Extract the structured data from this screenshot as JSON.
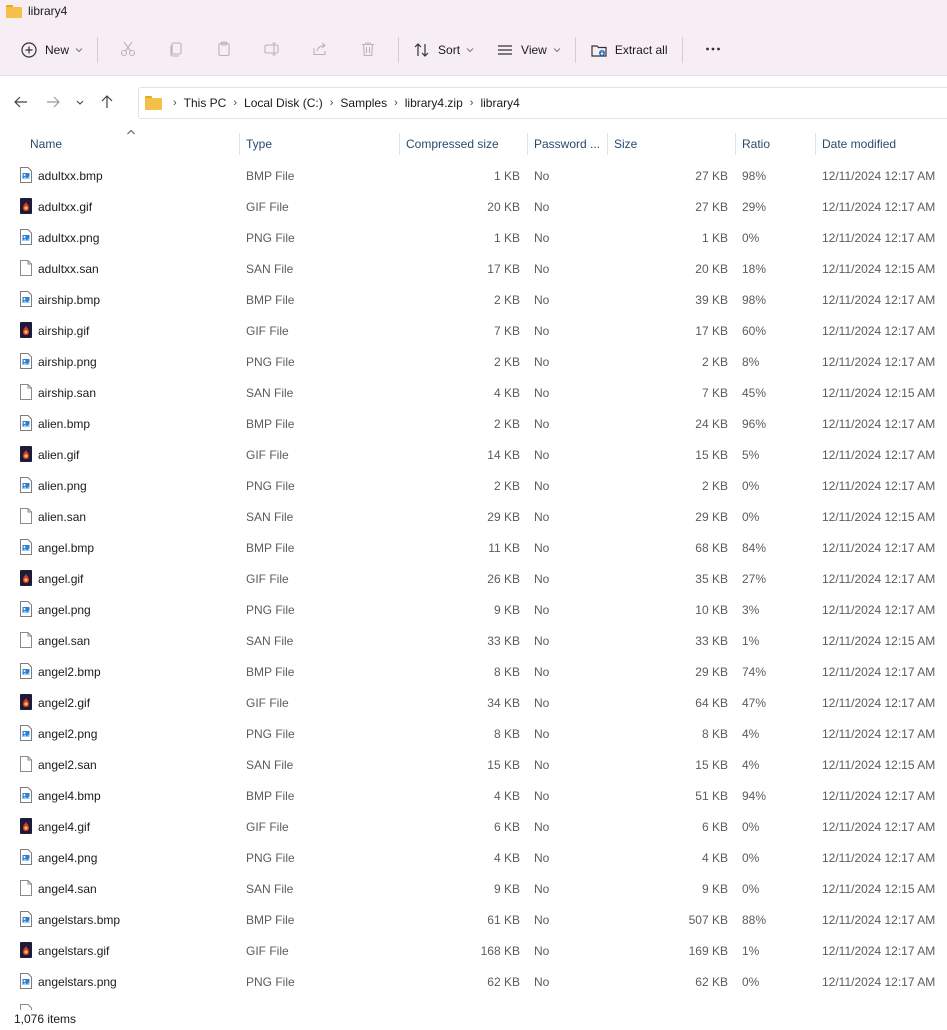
{
  "window": {
    "title": "library4"
  },
  "toolbar": {
    "new_label": "New",
    "sort_label": "Sort",
    "view_label": "View",
    "extract_label": "Extract all"
  },
  "address": {
    "crumbs": [
      "This PC",
      "Local Disk (C:)",
      "Samples",
      "library4.zip",
      "library4"
    ]
  },
  "columns": {
    "name": "Name",
    "type": "Type",
    "compressed": "Compressed size",
    "password": "Password ...",
    "size": "Size",
    "ratio": "Ratio",
    "date": "Date modified"
  },
  "files": [
    {
      "name": "adultxx.bmp",
      "type": "BMP File",
      "compressed": "1 KB",
      "password": "No",
      "size": "27 KB",
      "ratio": "98%",
      "date": "12/11/2024 12:17 AM",
      "icon": "image-file-icon"
    },
    {
      "name": "adultxx.gif",
      "type": "GIF File",
      "compressed": "20 KB",
      "password": "No",
      "size": "27 KB",
      "ratio": "29%",
      "date": "12/11/2024 12:17 AM",
      "icon": "gif-file-icon"
    },
    {
      "name": "adultxx.png",
      "type": "PNG File",
      "compressed": "1 KB",
      "password": "No",
      "size": "1 KB",
      "ratio": "0%",
      "date": "12/11/2024 12:17 AM",
      "icon": "image-file-icon"
    },
    {
      "name": "adultxx.san",
      "type": "SAN File",
      "compressed": "17 KB",
      "password": "No",
      "size": "20 KB",
      "ratio": "18%",
      "date": "12/11/2024 12:15 AM",
      "icon": "blank-file-icon"
    },
    {
      "name": "airship.bmp",
      "type": "BMP File",
      "compressed": "2 KB",
      "password": "No",
      "size": "39 KB",
      "ratio": "98%",
      "date": "12/11/2024 12:17 AM",
      "icon": "image-file-icon"
    },
    {
      "name": "airship.gif",
      "type": "GIF File",
      "compressed": "7 KB",
      "password": "No",
      "size": "17 KB",
      "ratio": "60%",
      "date": "12/11/2024 12:17 AM",
      "icon": "gif-file-icon"
    },
    {
      "name": "airship.png",
      "type": "PNG File",
      "compressed": "2 KB",
      "password": "No",
      "size": "2 KB",
      "ratio": "8%",
      "date": "12/11/2024 12:17 AM",
      "icon": "image-file-icon"
    },
    {
      "name": "airship.san",
      "type": "SAN File",
      "compressed": "4 KB",
      "password": "No",
      "size": "7 KB",
      "ratio": "45%",
      "date": "12/11/2024 12:15 AM",
      "icon": "blank-file-icon"
    },
    {
      "name": "alien.bmp",
      "type": "BMP File",
      "compressed": "2 KB",
      "password": "No",
      "size": "24 KB",
      "ratio": "96%",
      "date": "12/11/2024 12:17 AM",
      "icon": "image-file-icon"
    },
    {
      "name": "alien.gif",
      "type": "GIF File",
      "compressed": "14 KB",
      "password": "No",
      "size": "15 KB",
      "ratio": "5%",
      "date": "12/11/2024 12:17 AM",
      "icon": "gif-file-icon"
    },
    {
      "name": "alien.png",
      "type": "PNG File",
      "compressed": "2 KB",
      "password": "No",
      "size": "2 KB",
      "ratio": "0%",
      "date": "12/11/2024 12:17 AM",
      "icon": "image-file-icon"
    },
    {
      "name": "alien.san",
      "type": "SAN File",
      "compressed": "29 KB",
      "password": "No",
      "size": "29 KB",
      "ratio": "0%",
      "date": "12/11/2024 12:15 AM",
      "icon": "blank-file-icon"
    },
    {
      "name": "angel.bmp",
      "type": "BMP File",
      "compressed": "11 KB",
      "password": "No",
      "size": "68 KB",
      "ratio": "84%",
      "date": "12/11/2024 12:17 AM",
      "icon": "image-file-icon"
    },
    {
      "name": "angel.gif",
      "type": "GIF File",
      "compressed": "26 KB",
      "password": "No",
      "size": "35 KB",
      "ratio": "27%",
      "date": "12/11/2024 12:17 AM",
      "icon": "gif-file-icon"
    },
    {
      "name": "angel.png",
      "type": "PNG File",
      "compressed": "9 KB",
      "password": "No",
      "size": "10 KB",
      "ratio": "3%",
      "date": "12/11/2024 12:17 AM",
      "icon": "image-file-icon"
    },
    {
      "name": "angel.san",
      "type": "SAN File",
      "compressed": "33 KB",
      "password": "No",
      "size": "33 KB",
      "ratio": "1%",
      "date": "12/11/2024 12:15 AM",
      "icon": "blank-file-icon"
    },
    {
      "name": "angel2.bmp",
      "type": "BMP File",
      "compressed": "8 KB",
      "password": "No",
      "size": "29 KB",
      "ratio": "74%",
      "date": "12/11/2024 12:17 AM",
      "icon": "image-file-icon"
    },
    {
      "name": "angel2.gif",
      "type": "GIF File",
      "compressed": "34 KB",
      "password": "No",
      "size": "64 KB",
      "ratio": "47%",
      "date": "12/11/2024 12:17 AM",
      "icon": "gif-file-icon"
    },
    {
      "name": "angel2.png",
      "type": "PNG File",
      "compressed": "8 KB",
      "password": "No",
      "size": "8 KB",
      "ratio": "4%",
      "date": "12/11/2024 12:17 AM",
      "icon": "image-file-icon"
    },
    {
      "name": "angel2.san",
      "type": "SAN File",
      "compressed": "15 KB",
      "password": "No",
      "size": "15 KB",
      "ratio": "4%",
      "date": "12/11/2024 12:15 AM",
      "icon": "blank-file-icon"
    },
    {
      "name": "angel4.bmp",
      "type": "BMP File",
      "compressed": "4 KB",
      "password": "No",
      "size": "51 KB",
      "ratio": "94%",
      "date": "12/11/2024 12:17 AM",
      "icon": "image-file-icon"
    },
    {
      "name": "angel4.gif",
      "type": "GIF File",
      "compressed": "6 KB",
      "password": "No",
      "size": "6 KB",
      "ratio": "0%",
      "date": "12/11/2024 12:17 AM",
      "icon": "gif-file-icon"
    },
    {
      "name": "angel4.png",
      "type": "PNG File",
      "compressed": "4 KB",
      "password": "No",
      "size": "4 KB",
      "ratio": "0%",
      "date": "12/11/2024 12:17 AM",
      "icon": "image-file-icon"
    },
    {
      "name": "angel4.san",
      "type": "SAN File",
      "compressed": "9 KB",
      "password": "No",
      "size": "9 KB",
      "ratio": "0%",
      "date": "12/11/2024 12:15 AM",
      "icon": "blank-file-icon"
    },
    {
      "name": "angelstars.bmp",
      "type": "BMP File",
      "compressed": "61 KB",
      "password": "No",
      "size": "507 KB",
      "ratio": "88%",
      "date": "12/11/2024 12:17 AM",
      "icon": "image-file-icon"
    },
    {
      "name": "angelstars.gif",
      "type": "GIF File",
      "compressed": "168 KB",
      "password": "No",
      "size": "169 KB",
      "ratio": "1%",
      "date": "12/11/2024 12:17 AM",
      "icon": "gif-file-icon"
    },
    {
      "name": "angelstars.png",
      "type": "PNG File",
      "compressed": "62 KB",
      "password": "No",
      "size": "62 KB",
      "ratio": "0%",
      "date": "12/11/2024 12:17 AM",
      "icon": "image-file-icon"
    }
  ],
  "status": {
    "item_count": "1,076 items"
  },
  "colors": {
    "toolbar_bg": "#f7eef3",
    "header_text": "#2b4a6b",
    "folder": "#f5c04a"
  }
}
